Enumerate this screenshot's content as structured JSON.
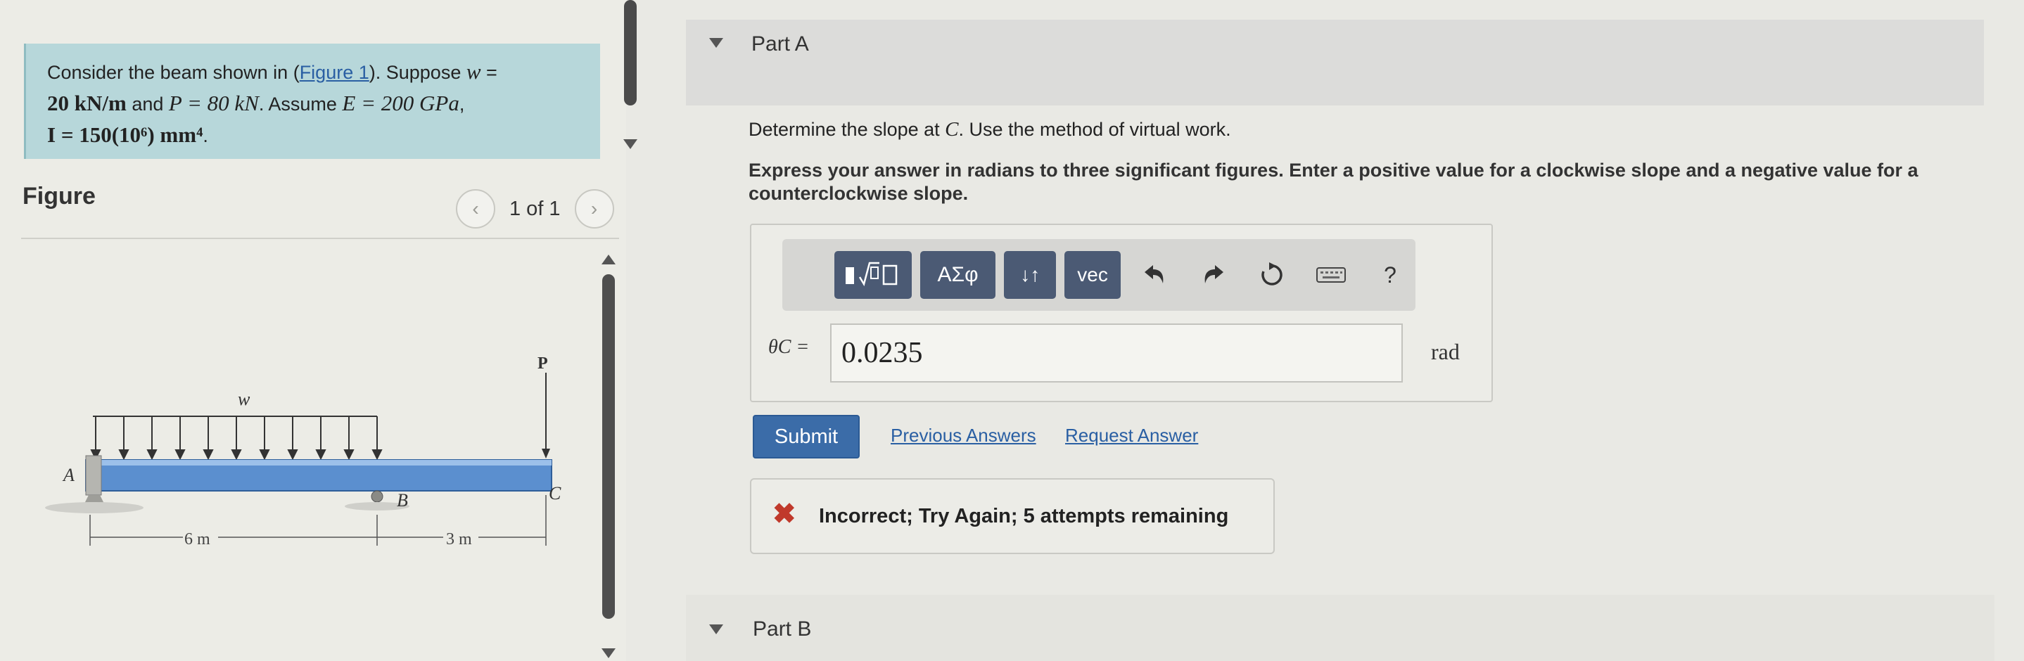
{
  "problem": {
    "line1_pre": "Consider the beam shown in (",
    "figure_link": "Figure 1",
    "line1_post": "). Suppose ",
    "w_sym": "w",
    "eq": " =",
    "line2": "20 kN/m",
    "and1": " and ",
    "p_eq": "P = 80 kN",
    "assume": ". Assume ",
    "e_eq": "E = 200 GPa",
    "comma": ",",
    "line3": "I = 150(10⁶) mm⁴",
    "period": "."
  },
  "figure": {
    "heading": "Figure",
    "page_label": "1 of 1",
    "prev_glyph": "‹",
    "next_glyph": "›",
    "labels": {
      "P": "P",
      "w": "w",
      "A": "A",
      "B": "B",
      "C": "C",
      "dim1": "6 m",
      "dim2": "3 m"
    }
  },
  "part_a": {
    "title": "Part A",
    "question_pre": "Determine the slope at ",
    "question_sym": "C",
    "question_post": ". Use the method of virtual work.",
    "instructions": "Express your answer in radians to three significant figures. Enter a positive value for a clockwise slope and a negative value for a counterclockwise slope.",
    "toolbar": {
      "templates_icon": "templates-icon",
      "greek_label": "ΑΣφ",
      "arrows_label": "↓↑",
      "vec_label": "vec",
      "help_label": "?"
    },
    "answer_label": "θC =",
    "answer_value": "0.0235",
    "unit": "rad",
    "submit_label": "Submit",
    "previous_answers": "Previous Answers",
    "request_answer": "Request Answer",
    "feedback": "Incorrect; Try Again; 5 attempts remaining",
    "feedback_icon": "✖"
  },
  "part_b": {
    "title": "Part B"
  },
  "colors": {
    "problem_bg": "#b7d7da",
    "submit_bg": "#3b6ca8",
    "toolbar_btn": "#4b5a74",
    "error": "#c0392b",
    "beam": "#5b8fcf"
  }
}
